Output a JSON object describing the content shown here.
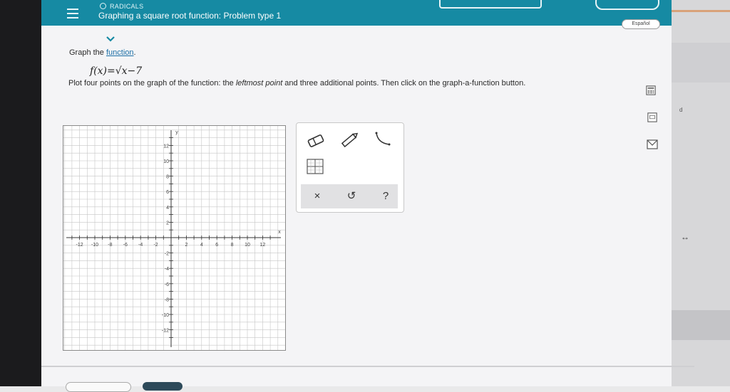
{
  "header": {
    "topic": "RADICALS",
    "title": "Graphing a square root function: Problem type 1",
    "language_button": "Español"
  },
  "problem": {
    "graph_prefix": "Graph the ",
    "graph_link": "function",
    "graph_suffix": ".",
    "formula": "f(x)=√x−7",
    "instr_part1": "Plot four points on the graph of the function: the ",
    "instr_emphasis": "leftmost point",
    "instr_part2": " and three additional points. Then click on the graph-a-function button."
  },
  "graph": {
    "x_ticks": [
      "-12",
      "-10",
      "-8",
      "-6",
      "-4",
      "-2",
      "2",
      "4",
      "6",
      "8",
      "10",
      "12"
    ],
    "y_ticks": [
      "12",
      "10",
      "8",
      "6",
      "4",
      "2",
      "-2",
      "-4",
      "-6",
      "-8",
      "-10",
      "-12"
    ],
    "x_label": "x",
    "y_label": "y",
    "grid_color": "#c6c6c6",
    "axis_color": "#333333"
  },
  "toolbox": {
    "tools": [
      "eraser-icon",
      "pencil-icon",
      "graph-a-function-icon",
      "point-grid-icon"
    ],
    "actions": {
      "clear": "×",
      "undo": "↺",
      "help": "?"
    }
  },
  "sidebar": {
    "char_right": "d"
  }
}
